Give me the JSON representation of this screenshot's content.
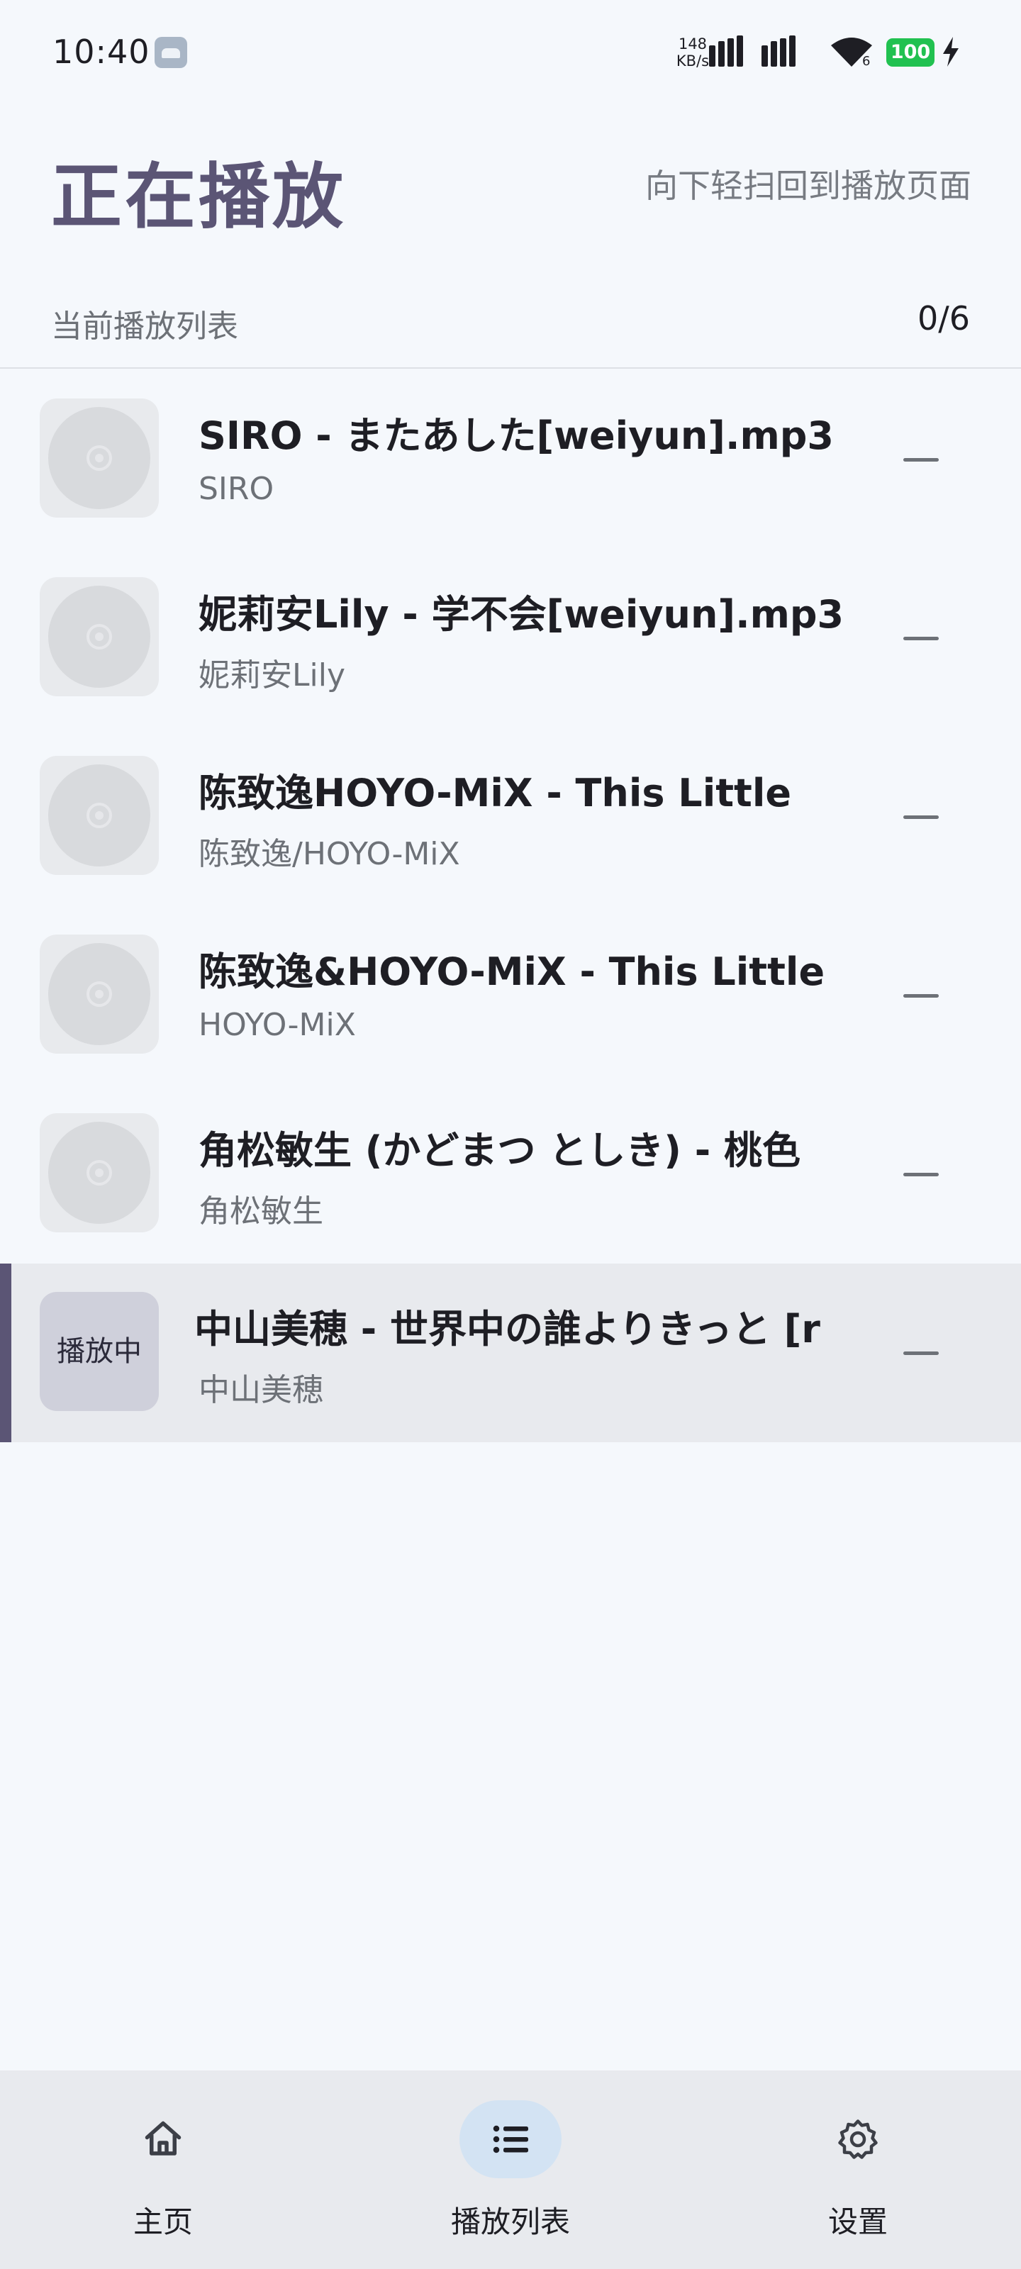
{
  "status_bar": {
    "time": "10:40",
    "net_speed_value": "148",
    "net_speed_unit": "KB/s",
    "wifi_sub": "6",
    "battery": "100",
    "battery_color": "#21c150"
  },
  "header": {
    "title": "正在播放",
    "hint": "向下轻扫回到播放页面"
  },
  "playlist": {
    "title": "当前播放列表",
    "count": "0/6",
    "playing_label": "播放中",
    "items": [
      {
        "title": "SIRO - またあした[weiyun].mp3",
        "artist": "SIRO"
      },
      {
        "title": "妮莉安Lily - 学不会[weiyun].mp3",
        "artist": "妮莉安Lily"
      },
      {
        "title": "陈致逸HOYO-MiX - This Little",
        "artist": "陈致逸/HOYO-MiX"
      },
      {
        "title": "陈致逸&HOYO-MiX - This Little",
        "artist": "HOYO-MiX"
      },
      {
        "title": "角松敏生 (かどまつ としき) - 桃色",
        "artist": "角松敏生"
      },
      {
        "title": "中山美穂 - 世界中の誰よりきっと [r",
        "artist": "中山美穂"
      }
    ]
  },
  "nav": {
    "items": [
      {
        "label": "主页",
        "icon": "home-icon"
      },
      {
        "label": "播放列表",
        "icon": "list-icon"
      },
      {
        "label": "设置",
        "icon": "settings-icon"
      }
    ],
    "selected": "播放列表"
  },
  "colors": {
    "accent": "#5b5575",
    "background": "#f5f8fc",
    "active_row": "#e8eaee",
    "nav_pill": "#d3e3f3"
  }
}
